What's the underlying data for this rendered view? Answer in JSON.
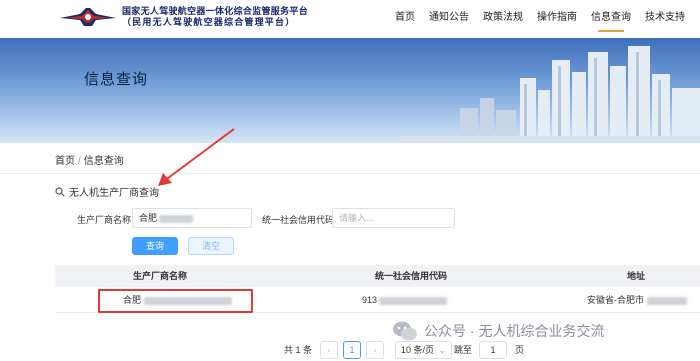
{
  "header": {
    "title_line1": "国家无人驾驶航空器一体化综合监管服务平台",
    "title_line2": "（民用无人驾驶航空器综合管理平台）",
    "nav": [
      {
        "label": "首页"
      },
      {
        "label": "通知公告"
      },
      {
        "label": "政策法规"
      },
      {
        "label": "操作指南"
      },
      {
        "label": "信息查询",
        "active": true
      },
      {
        "label": "技术支持"
      }
    ]
  },
  "banner": {
    "title": "信息查询"
  },
  "breadcrumb": {
    "home": "首页",
    "sep": "/",
    "current": "信息查询"
  },
  "section": {
    "title": "无人机生产厂商查询"
  },
  "form": {
    "manufacturer_label": "生产厂商名称",
    "manufacturer_value": "合肥",
    "credit_code_label": "统一社会信用代码",
    "credit_code_placeholder": "请输入...",
    "search_button": "查询",
    "clear_button": "清空"
  },
  "table": {
    "headers": [
      "生产厂商名称",
      "统一社会信用代码",
      "地址"
    ],
    "rows": [
      {
        "name": "合肥",
        "credit_code": "913",
        "address": "安徽省-合肥市"
      }
    ]
  },
  "pagination": {
    "total": "共 1 条",
    "prev": "‹",
    "current_page": "1",
    "next": "›",
    "page_size": "10 条/页",
    "jump_label": "跳至",
    "jump_value": "1",
    "page_unit": "页"
  },
  "watermark": {
    "text": "公众号 · 无人机综合业务交流"
  },
  "colors": {
    "primary": "#409eff",
    "annotation_red": "#e53935",
    "nav_active_underline": "#e6a23c"
  }
}
